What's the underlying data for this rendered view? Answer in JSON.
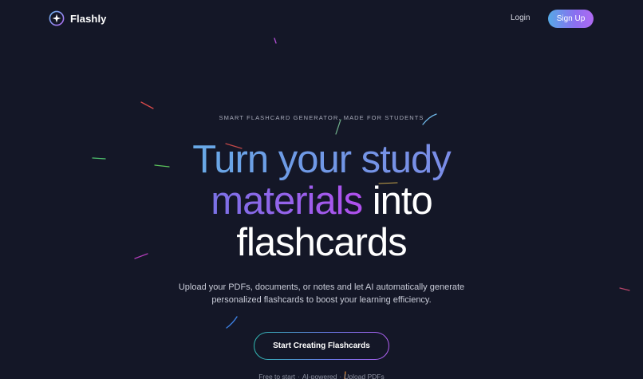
{
  "nav": {
    "brand": "Flashly",
    "login_label": "Login",
    "signup_label": "Sign Up"
  },
  "hero": {
    "eyebrow": "SMART FLASHCARD GENERATOR, MADE FOR STUDENTS",
    "headline": {
      "line1": "Turn your study",
      "line2_highlight": "materials",
      "line2_rest": " into",
      "line3": "flashcards"
    },
    "subtext": {
      "line1": "Upload your PDFs, documents, or notes and let AI automatically generate",
      "line2": "personalized flashcards to boost your learning efficiency."
    },
    "cta_label": "Start Creating Flashcards",
    "features": [
      "Free to start",
      "AI-powered",
      "Upload PDFs"
    ],
    "feature_separator": "·"
  },
  "colors": {
    "background": "#141727",
    "accent_blue": "#56a9e6",
    "accent_purple": "#b06af2",
    "accent_teal": "#2fb8b0"
  },
  "icons": {
    "logo": "sparkle-star-icon"
  }
}
